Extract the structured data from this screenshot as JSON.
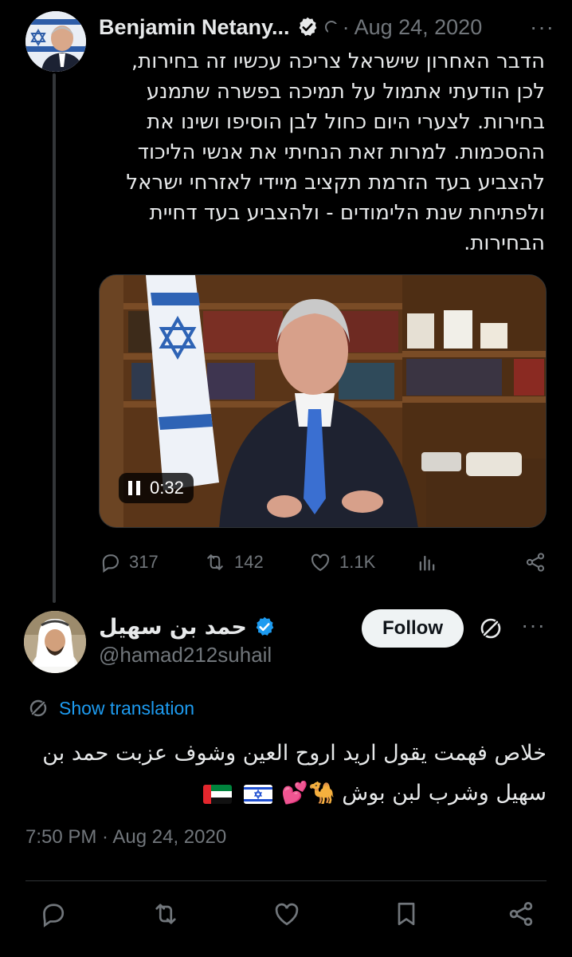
{
  "tweet1": {
    "author_name": "Benjamin Netany...",
    "date": "Aug 24, 2020",
    "more": "···",
    "text": "הדבר האחרון שישראל צריכה עכשיו זה בחירות, לכן הודעתי אתמול על תמיכה בפשרה שתמנע בחירות. לצערי היום כחול לבן הוסיפו ושינו את ההסכמות. למרות זאת הנחיתי את אנשי הליכוד להצביע בעד הזרמת תקציב מיידי לאזרחי ישראל ולפתיחת שנת הלימודים - ולהצביע בעד דחיית הבחירות.",
    "video": {
      "time": "0:32",
      "state": "playing"
    },
    "stats": {
      "replies": "317",
      "reposts": "142",
      "likes": "1.1K"
    }
  },
  "tweet2": {
    "author_name": "حمد بن سهيل",
    "handle": "@hamad212suhail",
    "follow_label": "Follow",
    "more": "···",
    "show_translation": "Show translation",
    "text": "خلاص فهمت يقول اريد اروح العين وشوف عزبت حمد بن سهيل وشرب لبن بوش",
    "emoji_tail": "🐪💕",
    "timestamp": "7:50 PM · Aug 24, 2020"
  },
  "colors": {
    "background": "#000000",
    "text": "#e7e9ea",
    "muted": "#71767b",
    "accent": "#1d9bf0",
    "divider": "#2f3336"
  },
  "icons": [
    "verified-badge-icon",
    "grok-icon",
    "reply-icon",
    "repost-icon",
    "like-icon",
    "views-icon",
    "share-icon",
    "bookmark-icon",
    "translate-icon",
    "pause-icon"
  ]
}
